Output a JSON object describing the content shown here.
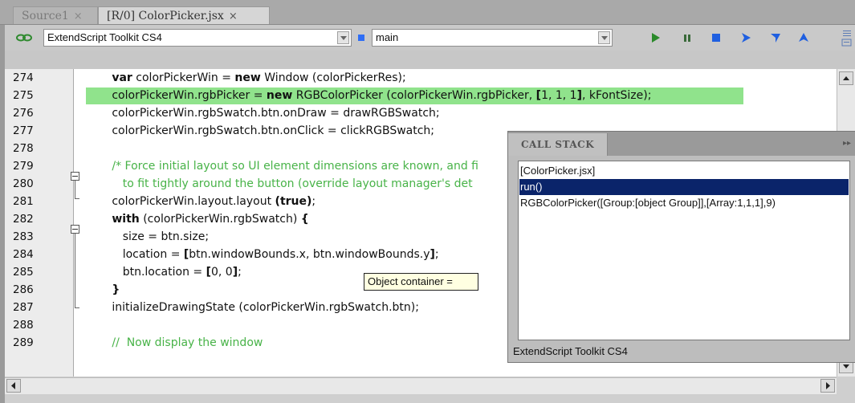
{
  "tabs": [
    {
      "label": "Source1",
      "close": "×"
    },
    {
      "label": "[R/0] ColorPicker.jsx",
      "close": "×"
    }
  ],
  "toolbar": {
    "target_value": "ExtendScript Toolkit CS4",
    "engine_value": "main",
    "icons": [
      "link-icon",
      "run-icon",
      "pause-icon",
      "stop-icon",
      "step-over-icon",
      "step-into-icon",
      "step-out-icon"
    ]
  },
  "editor": {
    "highlight_color": "#90e38c",
    "comment_color": "#48b348",
    "lines": [
      {
        "num": "274",
        "html": "   <b>var</b> colorPickerWin = <b>new</b> Window (colorPickerRes);"
      },
      {
        "num": "275",
        "html": "   colorPickerWin.rgbPicker = <b>new</b> RGBColorPicker (colorPickerWin.rgbPicker, <b>[</b>1, 1, 1<b>]</b>, kFontSize);"
      },
      {
        "num": "276",
        "html": "   colorPickerWin.rgbSwatch.btn.onDraw = drawRGBSwatch;"
      },
      {
        "num": "277",
        "html": "   colorPickerWin.rgbSwatch.btn.onClick = clickRGBSwatch;"
      },
      {
        "num": "278",
        "html": ""
      },
      {
        "num": "279",
        "html": "   <span class='comment'>/* Force initial layout so UI element dimensions are known, and fi</span>"
      },
      {
        "num": "280",
        "html": "   <span class='comment'>   to fit tightly around the button (override layout manager's det</span>"
      },
      {
        "num": "281",
        "html": "   colorPickerWin.layout.layout <b>(true)</b>;"
      },
      {
        "num": "282",
        "html": "   <b>with</b> (colorPickerWin.rgbSwatch) <b>{</b>"
      },
      {
        "num": "283",
        "html": "      size = btn.size;"
      },
      {
        "num": "284",
        "html": "      location = <b>[</b>btn.windowBounds.x, btn.windowBounds.y<b>]</b>;"
      },
      {
        "num": "285",
        "html": "      btn.location = <b>[</b>0, 0<b>]</b>;"
      },
      {
        "num": "286",
        "html": "   <b>}</b>"
      },
      {
        "num": "287",
        "html": "   initializeDrawingState (colorPickerWin.rgbSwatch.btn);"
      },
      {
        "num": "288",
        "html": ""
      },
      {
        "num": "289",
        "html": "   <span class='comment'>//  Now display the window</span>"
      }
    ]
  },
  "call_stack": {
    "title": "CALL STACK",
    "menu": "▸▸",
    "items": [
      "[ColorPicker.jsx]",
      "run()",
      "RGBColorPicker([Group:[object Group]],[Array:1,1,1],9)"
    ],
    "selected_index": 1,
    "status": "ExtendScript Toolkit CS4"
  },
  "tooltip": "Object container ="
}
